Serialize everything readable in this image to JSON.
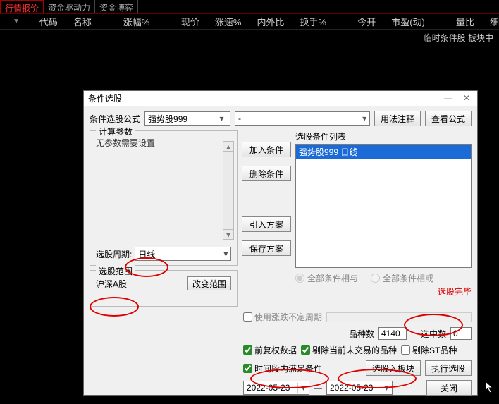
{
  "tabs": {
    "t0": "行情报价",
    "t1": "资金驱动力",
    "t2": "资金博弈"
  },
  "cols": {
    "c0": "代码",
    "c1": "名称",
    "c2": "涨幅%",
    "c3": "现价",
    "c4": "涨速%",
    "c5": "内外比",
    "c6": "换手%",
    "c7": "今开",
    "c8": "市盈(动)",
    "c9": "量比",
    "c10": "细"
  },
  "status": "临时条件股 板块中",
  "dialog": {
    "title": "条件选股",
    "formula_label": "条件选股公式",
    "formula_value": "强势股999",
    "formula_suffix": "-",
    "btn_usage": "用法注释",
    "btn_view": "查看公式",
    "calc_legend": "计算参数",
    "no_params": "无参数需要设置",
    "period_label": "选股周期:",
    "period_value": "日线",
    "scope_legend": "选股范围",
    "scope_value": "沪深A股",
    "btn_change_scope": "改变范围",
    "btn_add": "加入条件",
    "btn_del": "删除条件",
    "btn_import": "引入方案",
    "btn_save": "保存方案",
    "list_label": "选股条件列表",
    "list_item": "强势股999   日线",
    "radio_and": "全部条件相与",
    "radio_or": "全部条件相或",
    "done": "选股完毕",
    "use_undet": "使用涨跌不定周期",
    "variety_label": "品种数",
    "variety_value": "4140",
    "selected_label": "选中数",
    "selected_value": "0",
    "fq": "前复权数据",
    "rm_nontrade": "剔除当前未交易的品种",
    "rm_st": "剔除ST品种",
    "time_range": "时间段内满足条件",
    "btn_into_block": "选股入板块",
    "btn_exec": "执行选股",
    "date_from": "2022-05-23",
    "date_to": "2022-05-23",
    "btn_close": "关闭"
  }
}
